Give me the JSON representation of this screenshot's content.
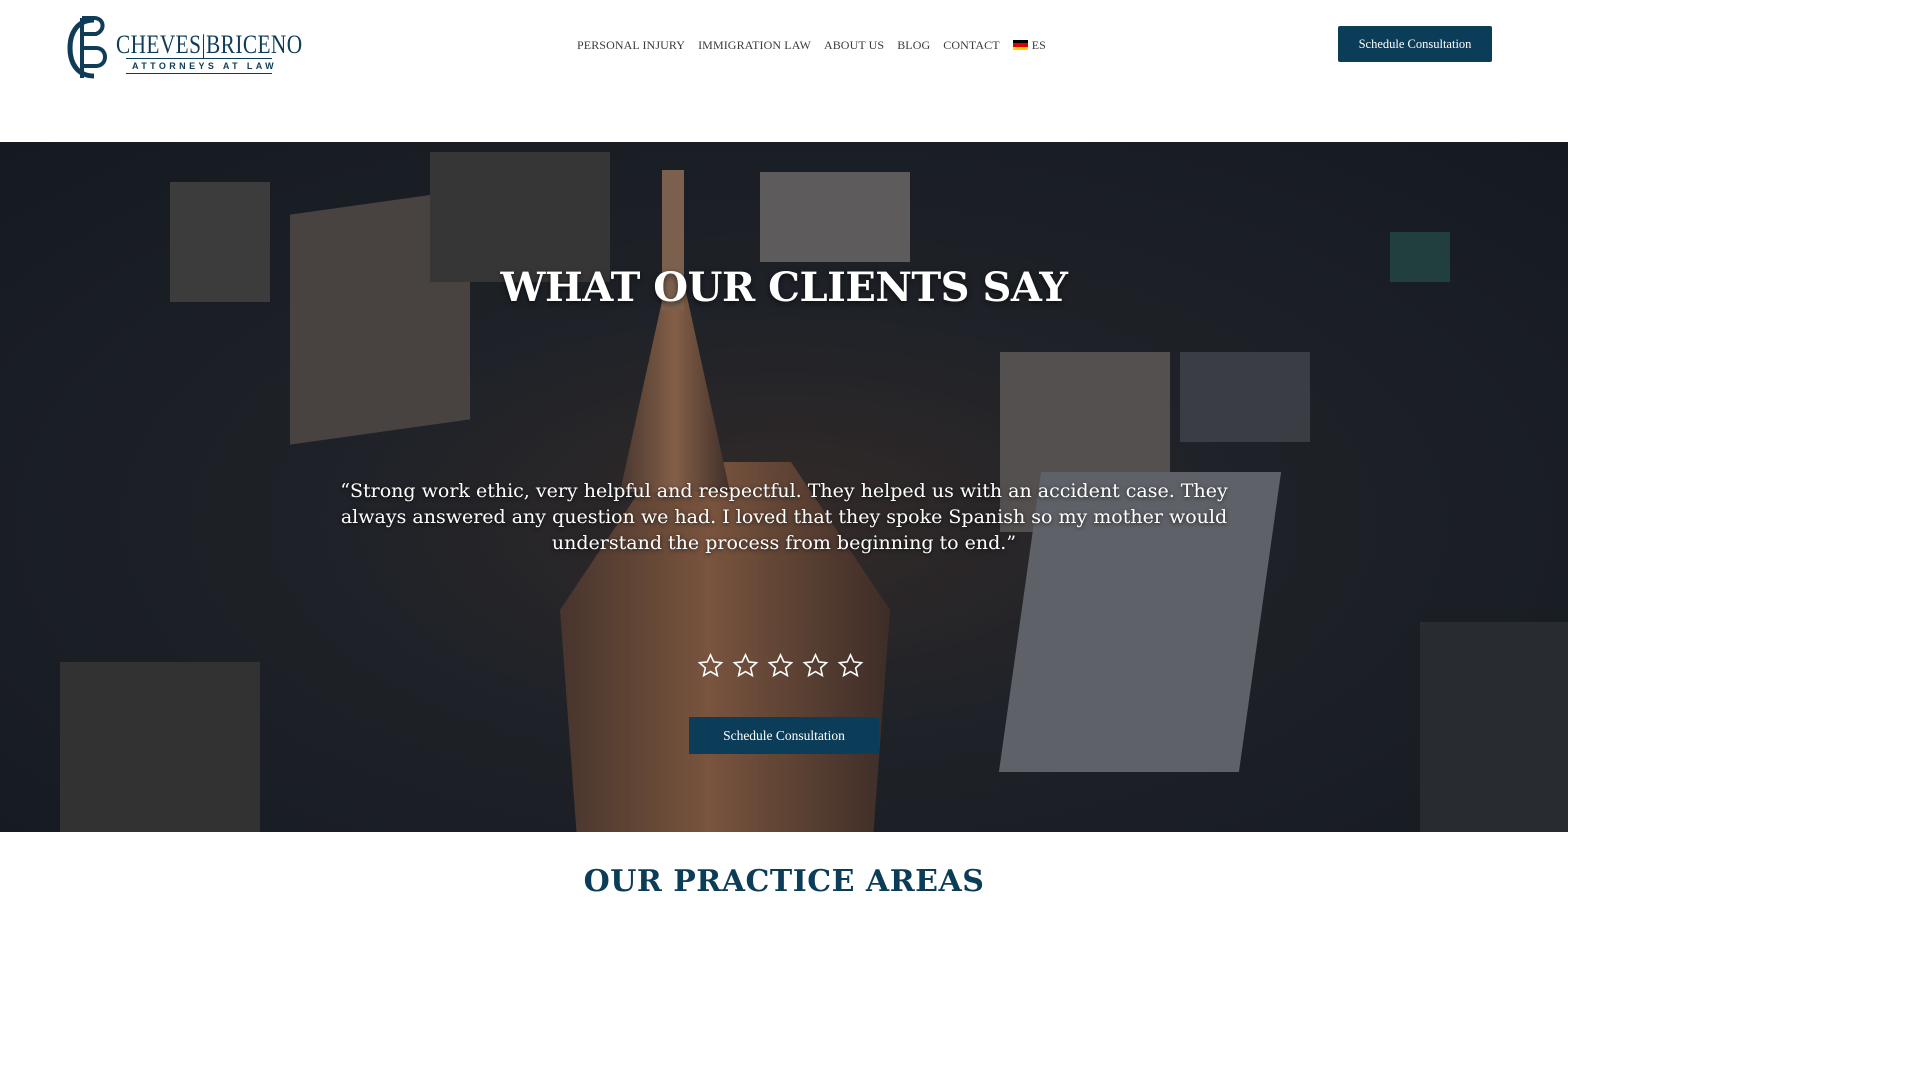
{
  "brand": {
    "name": "CHEVES|BRICENO",
    "tagline": "ATTORNEYS AT LAW",
    "color": "#0c3d58"
  },
  "nav": {
    "items": [
      "PERSONAL INJURY",
      "IMMIGRATION LAW",
      "ABOUT US",
      "BLOG",
      "CONTACT"
    ],
    "language": "ES",
    "language_icon": "flag-icon"
  },
  "header": {
    "cta_label": "Schedule Consultation"
  },
  "hero": {
    "title": "WHAT OUR CLIENTS SAY",
    "quote": "“Strong work ethic, very helpful and respectful. They helped us with an accident case. They always answered any question we had. I loved that they spoke Spanish so my mother would understand the process from beginning to end.”",
    "rating_stars": 5,
    "cta_label": "Schedule Consultation"
  },
  "next_section": {
    "title": "OUR PRACTICE AREAS"
  }
}
